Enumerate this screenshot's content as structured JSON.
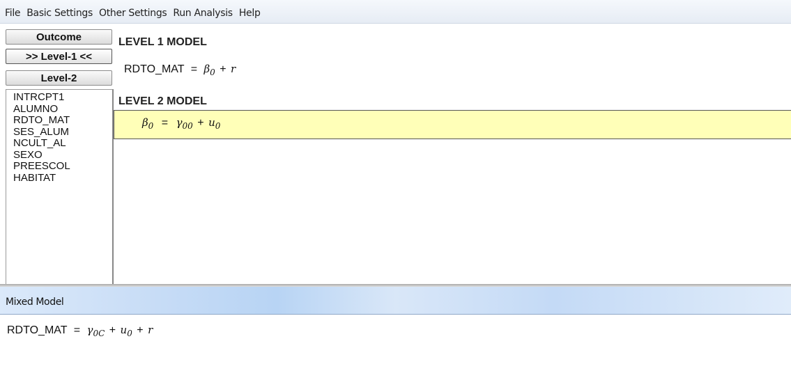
{
  "menu": [
    "File",
    "Basic Settings",
    "Other Settings",
    "Run Analysis",
    "Help"
  ],
  "buttons": {
    "outcome": "Outcome",
    "level1": ">> Level-1 <<",
    "level2": "Level-2"
  },
  "variables": [
    "INTRCPT1",
    "ALUMNO",
    "RDTO_MAT",
    "SES_ALUM",
    "NCULT_AL",
    "SEXO",
    "PREESCOL",
    "HABITAT"
  ],
  "level1": {
    "title": "LEVEL 1 MODEL",
    "lhs": "RDTO_MAT",
    "eq": "=",
    "beta": "β",
    "beta_sub": "0",
    "plus": "+",
    "r": "r"
  },
  "level2": {
    "title": "LEVEL 2 MODEL",
    "beta": "β",
    "beta_sub": "0",
    "eq": "=",
    "gamma": "γ",
    "gamma_sub": "00",
    "plus": "+",
    "u": "u",
    "u_sub": "0"
  },
  "mixed": {
    "title": "Mixed Model",
    "lhs": "RDTO_MAT",
    "eq": "=",
    "gamma": "γ",
    "gamma_sub": "0C",
    "plus1": "+",
    "u": "u",
    "u_sub": "0",
    "plus2": "+",
    "r": "r"
  },
  "colors": {
    "level2_highlight": "#ffffb8",
    "header_blue": "#c7dcf6"
  }
}
